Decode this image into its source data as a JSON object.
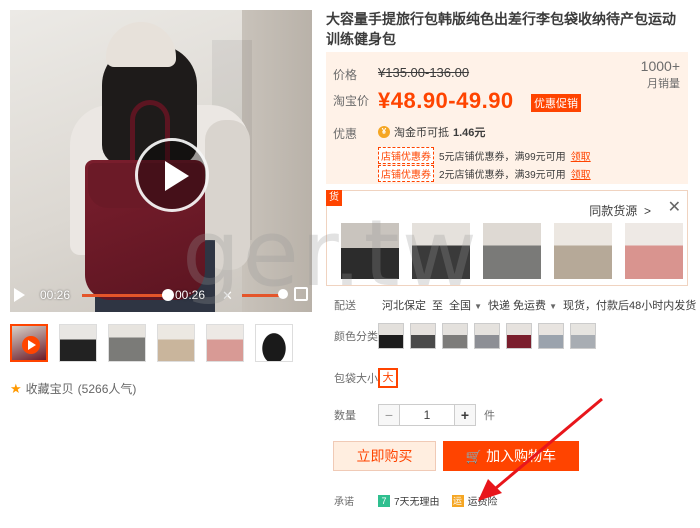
{
  "product": {
    "title": "大容量手提旅行包韩版纯色出差行李包袋收纳待产包运动训练健身包"
  },
  "video": {
    "current_time": "00:26",
    "duration": "00:26"
  },
  "thumbnails": [
    {
      "label": "video-thumb"
    },
    {
      "label": "black-bag"
    },
    {
      "label": "grey-bag"
    },
    {
      "label": "beige-bag"
    },
    {
      "label": "pink-bag"
    },
    {
      "label": "black-bag-flat"
    }
  ],
  "collect": {
    "label": "收藏宝贝",
    "count": "(5266人气)"
  },
  "price": {
    "orig_label": "价格",
    "orig_value": "¥135.00-136.00",
    "promo_label": "淘宝价",
    "promo_value": "¥48.90-49.90",
    "promo_badge": "优惠促销",
    "sales_count": "1000+",
    "sales_label": "月销量"
  },
  "discount": {
    "label": "优惠",
    "coin_text": "淘金币可抵",
    "coin_value": "1.46元",
    "coupons": [
      {
        "tag": "店铺优惠券",
        "text": "5元店铺优惠券，满99元可用",
        "action": "领取"
      },
      {
        "tag": "店铺优惠券",
        "text": "2元店铺优惠券，满39元可用",
        "action": "领取"
      }
    ]
  },
  "related": {
    "tag": "货",
    "header": "同款货源",
    "arrow": ">",
    "close": "✕"
  },
  "delivery": {
    "label": "配送",
    "from": "河北保定",
    "to_word": "至",
    "destination": "全国",
    "shipping": "快递 免运费",
    "note": "现货，付款后48小时内发货"
  },
  "color": {
    "label": "颜色分类"
  },
  "size": {
    "label": "包袋大小",
    "selected": "大"
  },
  "quantity": {
    "label": "数量",
    "value": "1",
    "minus": "−",
    "plus": "+",
    "unit": "件"
  },
  "actions": {
    "buy_now": "立即购买",
    "add_to_cart": "加入购物车"
  },
  "promise": {
    "label": "承诺",
    "items": [
      {
        "icon": "7",
        "text": "7天无理由",
        "color": "#2fbf8f"
      },
      {
        "icon": "运",
        "text": "运费险",
        "color": "#f5a623"
      }
    ]
  },
  "watermark": "ger.tw",
  "colors": {
    "accent": "#ff4400",
    "price_bg": "#fff2e8",
    "bag_red": "#6b1a27"
  }
}
